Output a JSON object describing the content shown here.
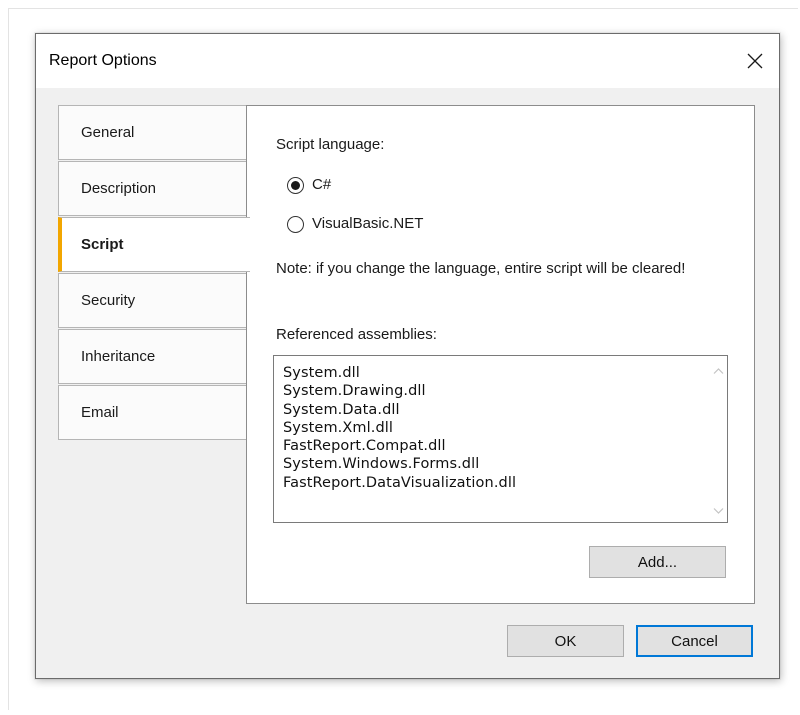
{
  "dialog": {
    "title": "Report Options"
  },
  "tabs": [
    {
      "label": "General",
      "active": false
    },
    {
      "label": "Description",
      "active": false
    },
    {
      "label": "Script",
      "active": true
    },
    {
      "label": "Security",
      "active": false
    },
    {
      "label": "Inheritance",
      "active": false
    },
    {
      "label": "Email",
      "active": false
    }
  ],
  "script": {
    "language_label": "Script language:",
    "options": [
      {
        "label": "C#",
        "selected": true
      },
      {
        "label": "VisualBasic.NET",
        "selected": false
      }
    ],
    "note": "Note: if you change the language, entire script will be cleared!",
    "assemblies_label": "Referenced assemblies:",
    "assemblies": [
      "System.dll",
      "System.Drawing.dll",
      "System.Data.dll",
      "System.Xml.dll",
      "FastReport.Compat.dll",
      "System.Windows.Forms.dll",
      "FastReport.DataVisualization.dll"
    ],
    "add_button": "Add..."
  },
  "footer": {
    "ok": "OK",
    "cancel": "Cancel"
  },
  "colors": {
    "active_tab_accent": "#f2a600",
    "default_button_border": "#0078d7"
  },
  "icons": {
    "close": "close-icon",
    "scroll_up": "chevron-up-icon",
    "scroll_down": "chevron-down-icon"
  }
}
